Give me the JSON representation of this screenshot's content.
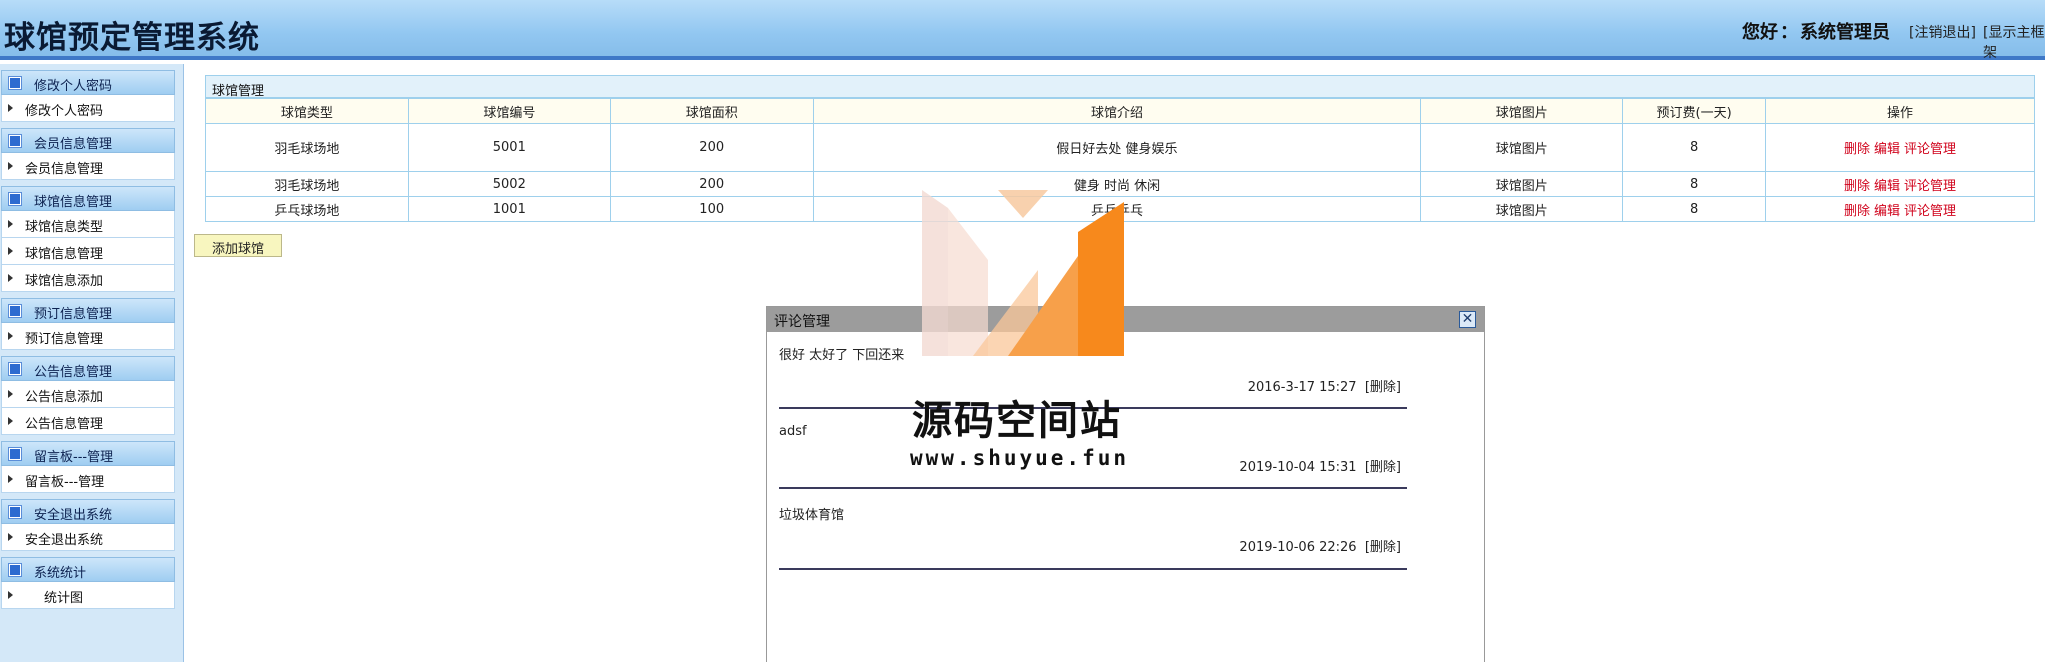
{
  "header": {
    "title": "球馆预定管理系统",
    "greeting_label": "您好",
    "user_name": "系统管理员",
    "logout_link": "[注销退出]",
    "main_link": "[显示主框架"
  },
  "sidebar": {
    "groups": [
      {
        "title": "修改个人密码",
        "items": [
          "修改个人密码"
        ]
      },
      {
        "title": "会员信息管理",
        "items": [
          "会员信息管理"
        ]
      },
      {
        "title": "球馆信息管理",
        "items": [
          "球馆信息类型",
          "球馆信息管理",
          "球馆信息添加"
        ]
      },
      {
        "title": "预订信息管理",
        "items": [
          "预订信息管理"
        ]
      },
      {
        "title": "公告信息管理",
        "items": [
          "公告信息添加",
          "公告信息管理"
        ]
      },
      {
        "title": "留言板---管理",
        "items": [
          "留言板---管理"
        ]
      },
      {
        "title": "安全退出系统",
        "items": [
          "安全退出系统"
        ]
      },
      {
        "title": "系统统计",
        "items": [
          "统计图"
        ]
      }
    ]
  },
  "main": {
    "panel_title": "球馆管理",
    "columns": [
      "球馆类型",
      "球馆编号",
      "球馆面积",
      "球馆介绍",
      "球馆图片",
      "预订费(一天)",
      "操作"
    ],
    "rows": [
      {
        "type": "羽毛球场地",
        "number": "5001",
        "area": "200",
        "intro": "假日好去处 健身娱乐",
        "image": "球馆图片",
        "fee": "8"
      },
      {
        "type": "羽毛球场地",
        "number": "5002",
        "area": "200",
        "intro": "健身 时尚 休闲",
        "image": "球馆图片",
        "fee": "8"
      },
      {
        "type": "乒乓球场地",
        "number": "1001",
        "area": "100",
        "intro": "乒乓乒乓",
        "image": "球馆图片",
        "fee": "8"
      }
    ],
    "actions": {
      "delete": "删除",
      "edit": "编辑",
      "comments": "评论管理"
    },
    "add_button": "添加球馆"
  },
  "dialog": {
    "title": "评论管理",
    "close_glyph": "✕",
    "delete_label": "[删除]",
    "comments": [
      {
        "text": "很好 太好了 下回还来",
        "time": "2016-3-17 15:27"
      },
      {
        "text": "adsf",
        "time": "2019-10-04 15:31"
      },
      {
        "text": "垃圾体育馆",
        "time": "2019-10-06 22:26"
      }
    ]
  },
  "watermark": {
    "name": "源码空间站",
    "url": "www.shuyue.fun"
  },
  "colors": {
    "header_bg": "#92c7f1",
    "header_border": "#3f78c7",
    "sidebar_bg": "#d4e8f8",
    "table_border": "#9ed0ec",
    "action_link": "#d0021b",
    "dialog_titlebar": "#9c9c9c",
    "watermark_orange": "#f7891c"
  }
}
